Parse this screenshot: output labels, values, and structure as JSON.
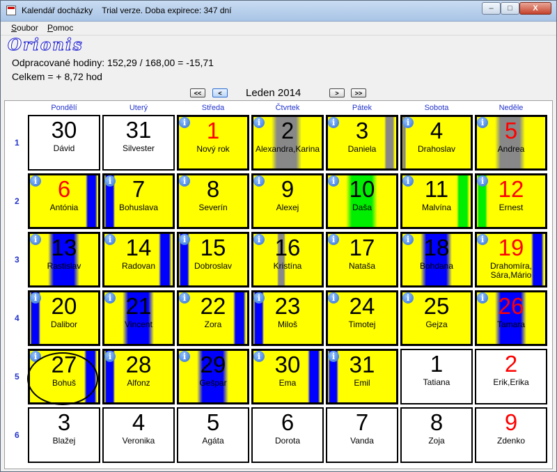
{
  "window": {
    "title": "Kalendář docházky",
    "subtitle": "Trial verze. Doba expirece: 347 dní",
    "min_label": "–",
    "max_label": "□",
    "close_label": "X"
  },
  "menu": {
    "file": "Soubor",
    "help": "Pomoc"
  },
  "logo": "Orionis",
  "summary": {
    "hours": "Odpracované hodiny: 152,29 / 168,00 = -15,71",
    "total": "Celkem = + 8,72 hod"
  },
  "nav": {
    "first": "<<",
    "prev": "<",
    "month": "Leden 2014",
    "next": ">",
    "last": ">>"
  },
  "colors": {
    "workday": "#ffff00",
    "other_month": "#ffffff",
    "vacation": "#0000ff",
    "sick": "#00ee00",
    "absent": "#888888",
    "holiday_text": "#ff0000"
  },
  "weekdays": [
    "Pondělí",
    "Uterý",
    "Středa",
    "Čtvrtek",
    "Pátek",
    "Sobota",
    "Neděle"
  ],
  "weeks": [
    "1",
    "2",
    "3",
    "4",
    "5",
    "6"
  ],
  "info_glyph": "i",
  "days": [
    {
      "n": "30",
      "name": "Dávid",
      "in": false,
      "red": false,
      "info": false
    },
    {
      "n": "31",
      "name": "Silvester",
      "in": false,
      "red": false,
      "info": false
    },
    {
      "n": "1",
      "name": "Nový rok",
      "in": true,
      "red": true,
      "info": true
    },
    {
      "n": "2",
      "name": "Alexandra,Karina",
      "in": true,
      "red": false,
      "info": true,
      "bars": [
        {
          "c": "absent",
          "l": 0.27,
          "w": 0.43
        }
      ]
    },
    {
      "n": "3",
      "name": "Daniela",
      "in": true,
      "red": false,
      "info": true,
      "bars": [
        {
          "c": "absent",
          "l": 0.83,
          "w": 0.15
        }
      ]
    },
    {
      "n": "4",
      "name": "Drahoslav",
      "in": true,
      "red": false,
      "info": true,
      "bars": [
        {
          "c": "absent",
          "l": 0.0,
          "w": 0.05
        }
      ]
    },
    {
      "n": "5",
      "name": "Andrea",
      "in": true,
      "red": true,
      "info": true,
      "bars": [
        {
          "c": "absent",
          "l": 0.27,
          "w": 0.43
        }
      ]
    },
    {
      "n": "6",
      "name": "Antónia",
      "in": true,
      "red": true,
      "info": true,
      "bars": [
        {
          "c": "vacation",
          "l": 0.82,
          "w": 0.17
        }
      ]
    },
    {
      "n": "7",
      "name": "Bohuslava",
      "in": true,
      "red": false,
      "info": true,
      "bars": [
        {
          "c": "vacation",
          "l": 0.0,
          "w": 0.15
        }
      ]
    },
    {
      "n": "8",
      "name": "Severín",
      "in": true,
      "red": false,
      "info": true
    },
    {
      "n": "9",
      "name": "Alexej",
      "in": true,
      "red": false,
      "info": true
    },
    {
      "n": "10",
      "name": "Daša",
      "in": true,
      "red": false,
      "info": true,
      "bars": [
        {
          "c": "sick",
          "l": 0.27,
          "w": 0.45
        }
      ]
    },
    {
      "n": "11",
      "name": "Malvína",
      "in": true,
      "red": false,
      "info": true,
      "bars": [
        {
          "c": "sick",
          "l": 0.8,
          "w": 0.18
        }
      ]
    },
    {
      "n": "12",
      "name": "Ernest",
      "in": true,
      "red": true,
      "info": true,
      "bars": [
        {
          "c": "sick",
          "l": 0.0,
          "w": 0.15
        }
      ]
    },
    {
      "n": "13",
      "name": "Rastislav",
      "in": true,
      "red": false,
      "info": true,
      "bars": [
        {
          "c": "vacation",
          "l": 0.27,
          "w": 0.45
        }
      ]
    },
    {
      "n": "14",
      "name": "Radovan",
      "in": true,
      "red": false,
      "info": true,
      "bars": [
        {
          "c": "vacation",
          "l": 0.8,
          "w": 0.18
        }
      ]
    },
    {
      "n": "15",
      "name": "Dobroslav",
      "in": true,
      "red": false,
      "info": true,
      "bars": [
        {
          "c": "vacation",
          "l": 0.0,
          "w": 0.15
        }
      ]
    },
    {
      "n": "16",
      "name": "Kristína",
      "in": true,
      "red": false,
      "info": true,
      "bars": [
        {
          "c": "absent",
          "l": 0.35,
          "w": 0.12
        }
      ]
    },
    {
      "n": "17",
      "name": "Nataša",
      "in": true,
      "red": false,
      "info": true
    },
    {
      "n": "18",
      "name": "Bohdana",
      "in": true,
      "red": false,
      "info": true,
      "bars": [
        {
          "c": "vacation",
          "l": 0.27,
          "w": 0.45
        }
      ]
    },
    {
      "n": "19",
      "name": "Drahomíra,\nSára,Mário",
      "in": true,
      "red": true,
      "info": true,
      "bars": [
        {
          "c": "vacation",
          "l": 0.8,
          "w": 0.18
        }
      ]
    },
    {
      "n": "20",
      "name": "Dalibor",
      "in": true,
      "red": false,
      "info": true,
      "bars": [
        {
          "c": "vacation",
          "l": 0.0,
          "w": 0.15
        }
      ]
    },
    {
      "n": "21",
      "name": "Vincent",
      "in": true,
      "red": false,
      "info": true,
      "bars": [
        {
          "c": "vacation",
          "l": 0.27,
          "w": 0.45
        }
      ]
    },
    {
      "n": "22",
      "name": "Zora",
      "in": true,
      "red": false,
      "info": true,
      "bars": [
        {
          "c": "vacation",
          "l": 0.8,
          "w": 0.18
        }
      ]
    },
    {
      "n": "23",
      "name": "Miloš",
      "in": true,
      "red": false,
      "info": true,
      "bars": [
        {
          "c": "vacation",
          "l": 0.0,
          "w": 0.15
        }
      ]
    },
    {
      "n": "24",
      "name": "Timotej",
      "in": true,
      "red": false,
      "info": true
    },
    {
      "n": "25",
      "name": "Gejza",
      "in": true,
      "red": false,
      "info": true
    },
    {
      "n": "26",
      "name": "Tamara",
      "in": true,
      "red": true,
      "info": true,
      "bars": [
        {
          "c": "vacation",
          "l": 0.27,
          "w": 0.45
        }
      ]
    },
    {
      "n": "27",
      "name": "Bohuš",
      "in": true,
      "red": false,
      "info": true,
      "bars": [
        {
          "c": "vacation",
          "l": 0.8,
          "w": 0.18
        }
      ]
    },
    {
      "n": "28",
      "name": "Alfonz",
      "in": true,
      "red": false,
      "info": true,
      "bars": [
        {
          "c": "vacation",
          "l": 0.0,
          "w": 0.15
        }
      ]
    },
    {
      "n": "29",
      "name": "Gešpar",
      "in": true,
      "red": false,
      "info": true,
      "bars": [
        {
          "c": "vacation",
          "l": 0.27,
          "w": 0.45
        }
      ]
    },
    {
      "n": "30",
      "name": "Ema",
      "in": true,
      "red": false,
      "info": true,
      "bars": [
        {
          "c": "vacation",
          "l": 0.8,
          "w": 0.18
        }
      ]
    },
    {
      "n": "31",
      "name": "Emil",
      "in": true,
      "red": false,
      "info": true,
      "bars": [
        {
          "c": "vacation",
          "l": 0.0,
          "w": 0.15
        }
      ]
    },
    {
      "n": "1",
      "name": "Tatiana",
      "in": false,
      "red": false,
      "info": false
    },
    {
      "n": "2",
      "name": "Erik,Erika",
      "in": false,
      "red": true,
      "info": false
    },
    {
      "n": "3",
      "name": "Blažej",
      "in": false,
      "red": false,
      "info": false
    },
    {
      "n": "4",
      "name": "Veronika",
      "in": false,
      "red": false,
      "info": false
    },
    {
      "n": "5",
      "name": "Agáta",
      "in": false,
      "red": false,
      "info": false
    },
    {
      "n": "6",
      "name": "Dorota",
      "in": false,
      "red": false,
      "info": false
    },
    {
      "n": "7",
      "name": "Vanda",
      "in": false,
      "red": false,
      "info": false
    },
    {
      "n": "8",
      "name": "Zoja",
      "in": false,
      "red": false,
      "info": false
    },
    {
      "n": "9",
      "name": "Zdenko",
      "in": false,
      "red": true,
      "info": false
    }
  ]
}
